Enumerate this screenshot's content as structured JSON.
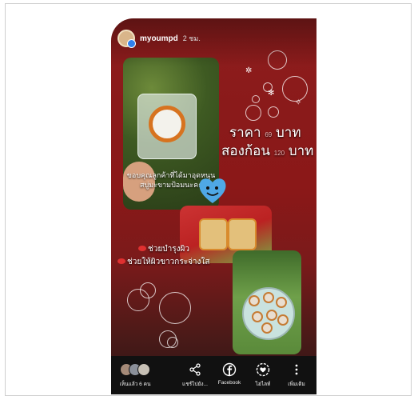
{
  "story": {
    "username": "myoumpd",
    "time_ago": "2 ชม.",
    "price_line1": "ราคา",
    "price_line1_small": "69",
    "price_line1_unit": "บาท",
    "price_line2": "สองก้อน",
    "price_line2_small": "120",
    "price_line2_unit": "บาท",
    "caption_thanks": "ขอบคุณลูกค้าที่ได้มาอุดหนุนสบู่มะขามป้อมนะคะ",
    "benefit_1": "ช่วยบำรุงผิว",
    "benefit_2": "ช่วยให้ผิวขาวกระจ่างใส"
  },
  "bottom_bar": {
    "viewers_label": "เห็นแล้ว 6 คน",
    "share_label": "แชร์ไปยัง...",
    "facebook_label": "Facebook",
    "highlight_label": "ไฮไลท์",
    "more_label": "เพิ่มเติม"
  },
  "icons": {
    "share": "share-icon",
    "facebook": "facebook-icon",
    "highlight": "highlight-icon",
    "more": "more-vertical-icon"
  },
  "colors": {
    "story_bg": "#8b1818",
    "bottom_bar": "#111111",
    "verified": "#2f80ed",
    "heart": "#4fa8e6"
  }
}
